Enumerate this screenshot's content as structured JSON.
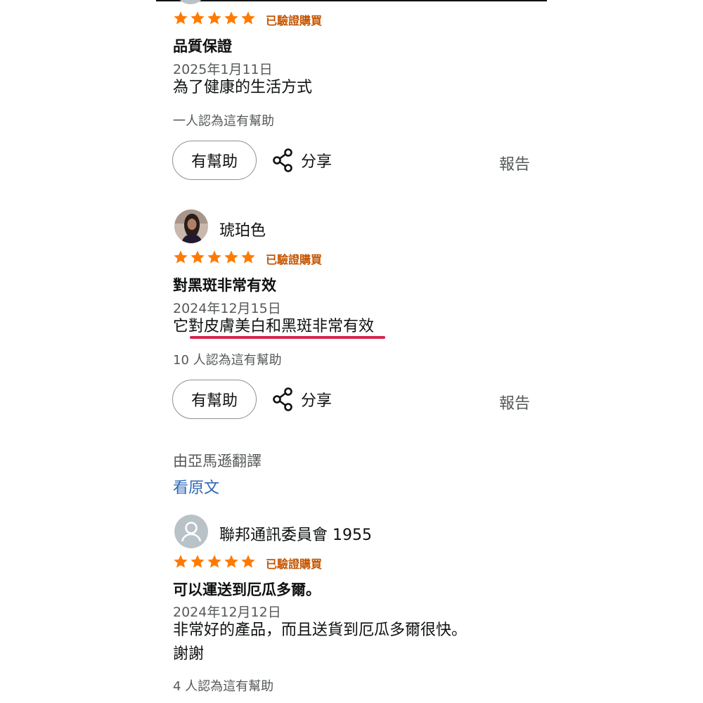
{
  "colors": {
    "star": "#ff7a00",
    "verified": "#c45500",
    "link": "#2f66b3",
    "underline": "#d6254f"
  },
  "reviews": [
    {
      "rating": 5,
      "verified_label": "已驗證購買",
      "title": "品質保證",
      "date": "2025年1月11日",
      "body": [
        "為了健康的生活方式"
      ],
      "helpful_count_text": "一人認為這有幫助",
      "helpful_button": "有幫助",
      "share_label": "分享",
      "report_label": "報告"
    },
    {
      "reviewer": "琥珀色",
      "avatar_icon": "user-photo-avatar",
      "rating": 5,
      "verified_label": "已驗證購買",
      "title": "對黑斑非常有效",
      "date": "2024年12月15日",
      "body": [
        "它對皮膚美白和黑斑非常有效"
      ],
      "helpful_count_text": "10 人認為這有幫助",
      "helpful_button": "有幫助",
      "share_label": "分享",
      "report_label": "報告",
      "translated_note": "由亞馬遜翻譯",
      "see_original": "看原文"
    },
    {
      "reviewer": "聯邦通訊委員會 1955",
      "avatar_icon": "default-user-icon",
      "rating": 5,
      "verified_label": "已驗證購買",
      "title": "可以運送到厄瓜多爾。",
      "date": "2024年12月12日",
      "body": [
        "非常好的產品，而且送貨到厄瓜多爾很快。",
        "謝謝"
      ],
      "helpful_count_text": "4 人認為這有幫助"
    }
  ]
}
